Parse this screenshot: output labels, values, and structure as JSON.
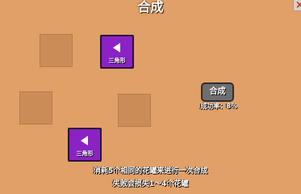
{
  "header": {
    "title": "合成",
    "close_label": "×"
  },
  "slots": [
    {
      "filled": false
    },
    {
      "filled": true,
      "item": {
        "label": "三角形",
        "icon": "triangle-left-icon"
      }
    },
    {
      "filled": false
    },
    {
      "filled": false
    },
    {
      "filled": true,
      "item": {
        "label": "三角形",
        "icon": "triangle-left-icon"
      }
    }
  ],
  "combine": {
    "button_label": "合成",
    "success_rate_text": "成功率：8%"
  },
  "instructions": {
    "line1": "消耗5个相同的花罐来进行一次合成",
    "line2": "失败会损失1～4个花罐"
  },
  "colors": {
    "background": "#e0a068",
    "slot": "#cb8c58",
    "card": "#8a22c4",
    "button": "#6e6e6e",
    "close_x": "#c0282c"
  }
}
